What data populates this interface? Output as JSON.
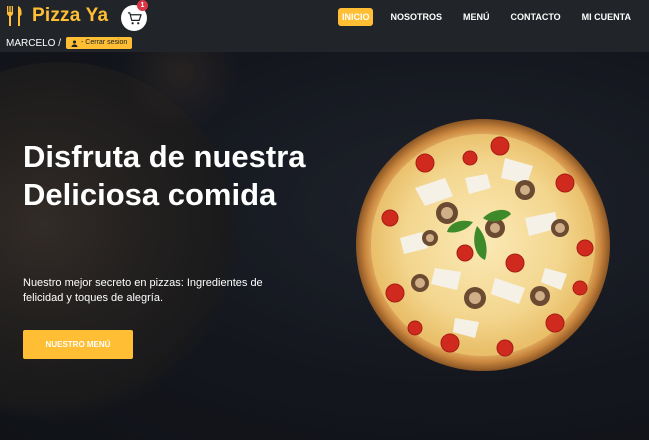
{
  "brand": {
    "name": "Pizza Ya",
    "icon": "fork-knife-icon",
    "color": "#ffbe33"
  },
  "cart": {
    "icon": "cart-icon",
    "count": "1"
  },
  "nav": {
    "items": [
      {
        "label": "INICIO",
        "active": true
      },
      {
        "label": "NOSOTROS",
        "active": false
      },
      {
        "label": "MENÚ",
        "active": false
      },
      {
        "label": "CONTACTO",
        "active": false
      },
      {
        "label": "MI CUENTA",
        "active": false
      }
    ]
  },
  "user": {
    "name": "MARCELO /",
    "logout_label": "- Cerrar sesion",
    "logout_icon": "user-icon"
  },
  "hero": {
    "title": "Disfruta de nuestra Deliciosa comida",
    "subtitle": "Nuestro mejor secreto en pizzas: Ingredientes de felicidad y toques de alegría.",
    "button_label": "NUESTRO MENÚ",
    "image": "pizza-image"
  },
  "colors": {
    "accent": "#ffbe33",
    "dark": "#212529",
    "badge": "#dc3545"
  }
}
